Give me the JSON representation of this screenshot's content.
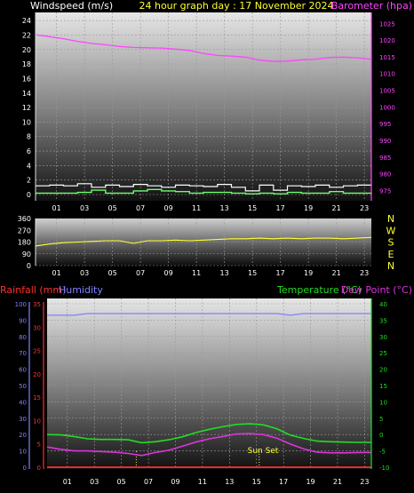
{
  "header": {
    "left_label": "Windspeed (m/s)",
    "title": "24 hour graph day : 17 November 2024",
    "right_label": "Barometer (hpa)"
  },
  "panel3_header": {
    "rainfall_label": "Rainfall (mm)",
    "humidity_label": "Humidity",
    "temperature_label": "Temperature (°C)",
    "dewpoint_label": "Dew Point (°C)"
  },
  "annotation": {
    "sunset": "Sun Set"
  },
  "colors": {
    "windspeed": "#ffffff",
    "gust_label": "#ffffff",
    "wind_avg": "#6cff6c",
    "barometer": "#ff44ff",
    "direction": "#ffff33",
    "rainfall": "#ff3030",
    "humidity": "#8080ff",
    "temperature": "#22dd22",
    "dewpoint": "#dd33dd",
    "sunset": "#ffff33"
  },
  "chart_data": [
    {
      "type": "line",
      "title": "24 hour graph day : 17 November 2024",
      "x_ticks": [
        "01",
        "03",
        "05",
        "07",
        "09",
        "11",
        "13",
        "15",
        "17",
        "19",
        "21",
        "23"
      ],
      "x_range": [
        0,
        24
      ],
      "y_left": {
        "label": "Windspeed (m/s)",
        "ticks": [
          0,
          2,
          4,
          6,
          8,
          10,
          12,
          14,
          16,
          18,
          20,
          22,
          24
        ],
        "range": [
          0,
          25
        ]
      },
      "y_right": {
        "label": "Barometer (hpa)",
        "ticks": [
          975,
          980,
          985,
          990,
          995,
          1000,
          1005,
          1010,
          1015,
          1020,
          1025
        ],
        "range": [
          973,
          1028
        ]
      },
      "series": [
        {
          "name": "Barometer (hpa)",
          "axis": "right",
          "x": [
            0,
            1,
            2,
            3,
            4,
            5,
            6,
            7,
            8,
            9,
            10,
            11,
            12,
            13,
            14,
            15,
            16,
            17,
            18,
            19,
            20,
            21,
            22,
            23,
            24
          ],
          "y": [
            1021.6,
            1021.0,
            1020.4,
            1019.6,
            1019.0,
            1018.6,
            1018.1,
            1017.8,
            1017.7,
            1017.6,
            1017.3,
            1016.9,
            1016.0,
            1015.4,
            1015.2,
            1014.9,
            1014.0,
            1013.6,
            1013.7,
            1014.1,
            1014.3,
            1014.8,
            1014.9,
            1014.7,
            1014.3
          ]
        },
        {
          "name": "Gust",
          "axis": "left",
          "x": [
            0,
            1,
            2,
            3,
            4,
            5,
            6,
            7,
            8,
            9,
            10,
            11,
            12,
            13,
            14,
            15,
            16,
            17,
            18,
            19,
            20,
            21,
            22,
            23,
            24
          ],
          "y": [
            1.2,
            1.3,
            1.2,
            1.5,
            1.0,
            1.3,
            1.1,
            1.4,
            1.2,
            1.0,
            1.3,
            1.2,
            1.1,
            1.4,
            1.0,
            0.5,
            1.3,
            0.6,
            1.2,
            1.1,
            1.3,
            1.0,
            1.2,
            1.3,
            1.2
          ]
        },
        {
          "name": "Windspeed",
          "axis": "left",
          "x": [
            0,
            1,
            2,
            3,
            4,
            5,
            6,
            7,
            8,
            9,
            10,
            11,
            12,
            13,
            14,
            15,
            16,
            17,
            18,
            19,
            20,
            21,
            22,
            23,
            24
          ],
          "y": [
            0.2,
            0.2,
            0.2,
            0.3,
            0.6,
            0.2,
            0.2,
            0.5,
            0.7,
            0.5,
            0.4,
            0.2,
            0.3,
            0.3,
            0.2,
            0.1,
            0.2,
            0.1,
            0.3,
            0.2,
            0.2,
            0.4,
            0.2,
            0.2,
            0.3
          ]
        }
      ]
    },
    {
      "type": "line",
      "title": "",
      "x_ticks": [
        "01",
        "03",
        "05",
        "07",
        "09",
        "11",
        "13",
        "15",
        "17",
        "19",
        "21",
        "23"
      ],
      "x_range": [
        0,
        24
      ],
      "y_left": {
        "label": "",
        "ticks": [
          0,
          90,
          180,
          270,
          360
        ],
        "range": [
          0,
          360
        ]
      },
      "y_right": {
        "label": "",
        "ticks": [
          "N",
          "W",
          "S",
          "E",
          "N"
        ]
      },
      "series": [
        {
          "name": "Wind direction",
          "x": [
            0,
            1,
            2,
            3,
            4,
            5,
            6,
            7,
            8,
            9,
            10,
            11,
            12,
            13,
            14,
            15,
            16,
            17,
            18,
            19,
            20,
            21,
            22,
            23,
            24
          ],
          "y": [
            150,
            165,
            175,
            180,
            185,
            190,
            190,
            170,
            190,
            190,
            195,
            190,
            195,
            200,
            205,
            205,
            210,
            205,
            210,
            205,
            210,
            210,
            205,
            210,
            215
          ]
        }
      ]
    },
    {
      "type": "line",
      "title": "",
      "x_ticks": [
        "01",
        "03",
        "05",
        "07",
        "09",
        "11",
        "13",
        "15",
        "17",
        "19",
        "21",
        "23"
      ],
      "x_range": [
        0,
        24
      ],
      "y_humidity": {
        "label": "Humidity",
        "ticks": [
          0,
          10,
          20,
          30,
          40,
          50,
          60,
          70,
          80,
          90,
          100
        ],
        "range": [
          0,
          100
        ]
      },
      "y_rainfall": {
        "label": "Rainfall (mm)",
        "ticks": [
          0,
          5,
          10,
          15,
          20,
          25,
          30,
          35
        ],
        "range": [
          0,
          35
        ]
      },
      "y_right": {
        "label": "Temperature (°C)",
        "ticks": [
          -10,
          -5,
          0,
          5,
          10,
          15,
          20,
          25,
          30,
          35,
          40
        ],
        "range": [
          -10,
          40
        ]
      },
      "series": [
        {
          "name": "Humidity",
          "x": [
            0,
            1,
            2,
            3,
            4,
            5,
            6,
            7,
            8,
            9,
            10,
            11,
            12,
            13,
            14,
            15,
            16,
            17,
            18,
            19,
            20,
            21,
            22,
            23,
            24
          ],
          "y": [
            93,
            93,
            93,
            94,
            94,
            94,
            94,
            94,
            94,
            94,
            94,
            94,
            94,
            94,
            94,
            94,
            94,
            94,
            93,
            94,
            94,
            94,
            94,
            94,
            94
          ]
        },
        {
          "name": "Temperature (°C)",
          "x": [
            0,
            1,
            2,
            3,
            4,
            5,
            6,
            7,
            8,
            9,
            10,
            11,
            12,
            13,
            14,
            15,
            16,
            17,
            18,
            19,
            20,
            21,
            22,
            23,
            24
          ],
          "y": [
            0.0,
            -0.1,
            -0.6,
            -1.3,
            -1.5,
            -1.5,
            -1.6,
            -2.5,
            -2.2,
            -1.6,
            -0.7,
            0.6,
            1.6,
            2.4,
            3.1,
            3.3,
            3.0,
            1.8,
            -0.2,
            -1.2,
            -2.0,
            -2.2,
            -2.3,
            -2.4,
            -2.4
          ]
        },
        {
          "name": "Dew Point (°C)",
          "x": [
            0,
            1,
            2,
            3,
            4,
            5,
            6,
            7,
            8,
            9,
            10,
            11,
            12,
            13,
            14,
            15,
            16,
            17,
            18,
            19,
            20,
            21,
            22,
            23,
            24
          ],
          "y": [
            -3.8,
            -4.5,
            -5.0,
            -5.0,
            -5.2,
            -5.4,
            -5.8,
            -6.4,
            -5.5,
            -4.8,
            -3.6,
            -2.3,
            -1.3,
            -0.6,
            0.2,
            0.3,
            0.0,
            -1.1,
            -2.9,
            -4.4,
            -5.4,
            -5.6,
            -5.6,
            -5.5,
            -5.5
          ]
        },
        {
          "name": "Rainfall (mm)",
          "x": [
            0,
            1,
            2,
            3,
            4,
            5,
            6,
            7,
            8,
            9,
            10,
            11,
            12,
            13,
            14,
            15,
            16,
            17,
            18,
            19,
            20,
            21,
            22,
            23,
            24
          ],
          "y": [
            0,
            0,
            0,
            0,
            0,
            0,
            0,
            0,
            0,
            0,
            0,
            0,
            0,
            0,
            0,
            0,
            0,
            0,
            0,
            0,
            0,
            0,
            0,
            0,
            0
          ]
        }
      ],
      "markers": [
        {
          "x": 6.6,
          "style": "dotted"
        },
        {
          "x": 15.7,
          "style": "dotted",
          "label": "Sun Set"
        }
      ]
    }
  ]
}
